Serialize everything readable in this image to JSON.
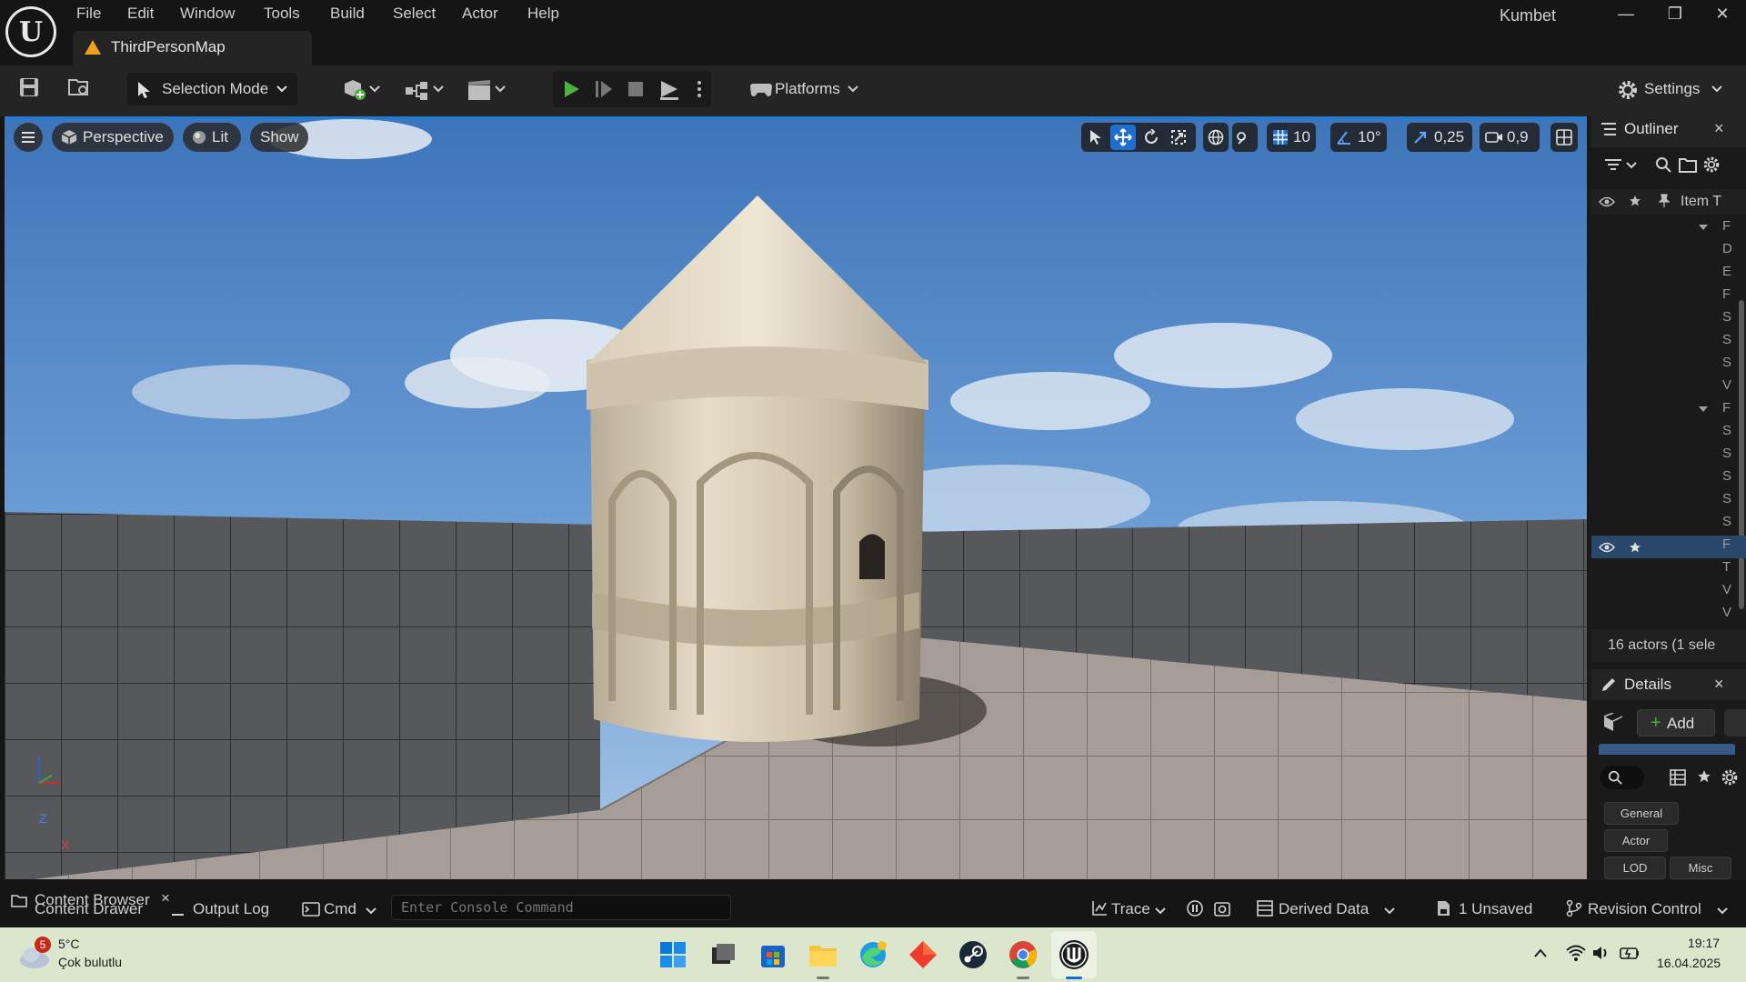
{
  "app": {
    "project_name": "Kumbet",
    "map_tab": "ThirdPersonMap",
    "logo_letter": "U",
    "menu": [
      "File",
      "Edit",
      "Window",
      "Tools",
      "Build",
      "Select",
      "Actor",
      "Help"
    ],
    "window_controls": {
      "minimize": "—",
      "restore": "❐",
      "close": "✕"
    }
  },
  "toolbar": {
    "selection_mode": "Selection Mode",
    "platforms": "Platforms",
    "settings": "Settings",
    "accent_play": "#4caf3f"
  },
  "viewport": {
    "perspective": "Perspective",
    "lit": "Lit",
    "show": "Show",
    "grid_snap": "10",
    "rotation_snap": "10°",
    "scale_snap": "0,25",
    "camera_speed": "0,9",
    "axis_z": "Z",
    "axis_x": "X",
    "accent": "#1f7ad1"
  },
  "outliner": {
    "title": "Outliner",
    "close": "×",
    "column_item": "Item T",
    "rows": [
      "F",
      "D",
      "E",
      "F",
      "S",
      "S",
      "S",
      "V",
      "F",
      "S",
      "S",
      "S",
      "S",
      "S",
      "F",
      "T",
      "V",
      "V"
    ],
    "status": "16 actors (1 sele",
    "selected_color": "#29476b"
  },
  "details": {
    "title": "Details",
    "close": "×",
    "add": "Add",
    "categories": [
      "General",
      "Actor",
      "LOD",
      "Misc"
    ]
  },
  "statusbar": {
    "content_browser": "Content Browser",
    "content_drawer": "Content Drawer",
    "content_browser_close": "×",
    "output_log": "Output Log",
    "cmd": "Cmd",
    "console_placeholder": "Enter Console Command",
    "trace": "Trace",
    "derived_data": "Derived Data",
    "unsaved": "1 Unsaved",
    "revision_control": "Revision Control"
  },
  "taskbar": {
    "weather_temp": "5°C",
    "weather_desc": "Çok bulutlu",
    "weather_badge": "5",
    "time": "19:17",
    "date": "16.04.2025"
  }
}
